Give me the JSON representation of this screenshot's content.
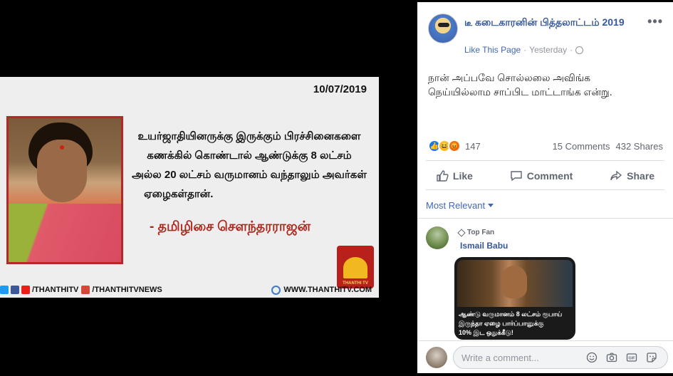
{
  "photo": {
    "date": "10/07/2019",
    "quote_lines": [
      "உயர்ஜாதியினருக்கு இருக்கும் பிரச்சினைகளை",
      "கணக்கில் கொண்டால் ஆண்டுக்கு 8 லட்சம்",
      "அல்ல 20 லட்சம் வருமானம் வந்தாலும் அவர்கள்",
      "ஏழைகள்தான்."
    ],
    "author": "- தமிழிசை சௌந்தரராஜன்",
    "logo_text": "THANTHI TV",
    "footer_left": "/THANTHITV",
    "footer_mid": "/THANTHITVNEWS",
    "footer_right": "WWW.THANTHITV.COM"
  },
  "post": {
    "page_name": "டீ கடைகாரனின் பித்தலாட்டம் 2019",
    "like_page": "Like This Page",
    "separator": "·",
    "time": "Yesterday",
    "text_line1": "நான் அப்பவே சொல்லலை அவிங்க",
    "text_line2": "நெய்யில்லாம சாப்பிட மாட்டாங்க என்று.",
    "reactions_count": "147",
    "comments": "15 Comments",
    "shares": "432 Shares",
    "like_label": "Like",
    "comment_label": "Comment",
    "share_label": "Share",
    "sort_label": "Most Relevant"
  },
  "comment": {
    "badge": "Top Fan",
    "author": "Ismail Babu",
    "meme_line1": "ஆண்டு வருமானம் 8 லட்சம் ரூபாய்",
    "meme_line2": "இருந்தா ஏழை பார்ப்பானுக்கு",
    "meme_line3": "10% இட ஒதுக்கீடு!"
  },
  "composer": {
    "placeholder": "Write a comment..."
  },
  "colors": {
    "link": "#365899",
    "accent": "#4267b2",
    "brand_red": "#b8211b"
  },
  "icons": [
    "more-icon",
    "globe-icon",
    "like-icon",
    "comment-icon",
    "share-icon",
    "emoji-icon",
    "camera-icon",
    "gif-icon",
    "sticker-icon",
    "top-fan-icon"
  ]
}
